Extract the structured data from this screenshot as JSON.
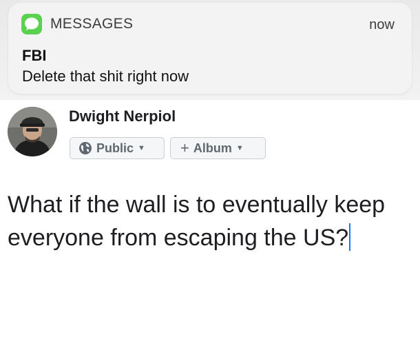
{
  "notification": {
    "app_name": "MESSAGES",
    "time": "now",
    "sender": "FBI",
    "body": "Delete that shit right now",
    "app_icon": "messages-bubble-icon",
    "accent_color": "#5ad14f"
  },
  "composer": {
    "user_name": "Dwight Nerpiol",
    "privacy_label": "Public",
    "privacy_icon": "globe-icon",
    "album_label": "Album",
    "album_icon": "plus-icon",
    "post_text": "What if the wall is to eventually keep everyone from escaping the US?",
    "cursor_color": "#1877f2"
  }
}
